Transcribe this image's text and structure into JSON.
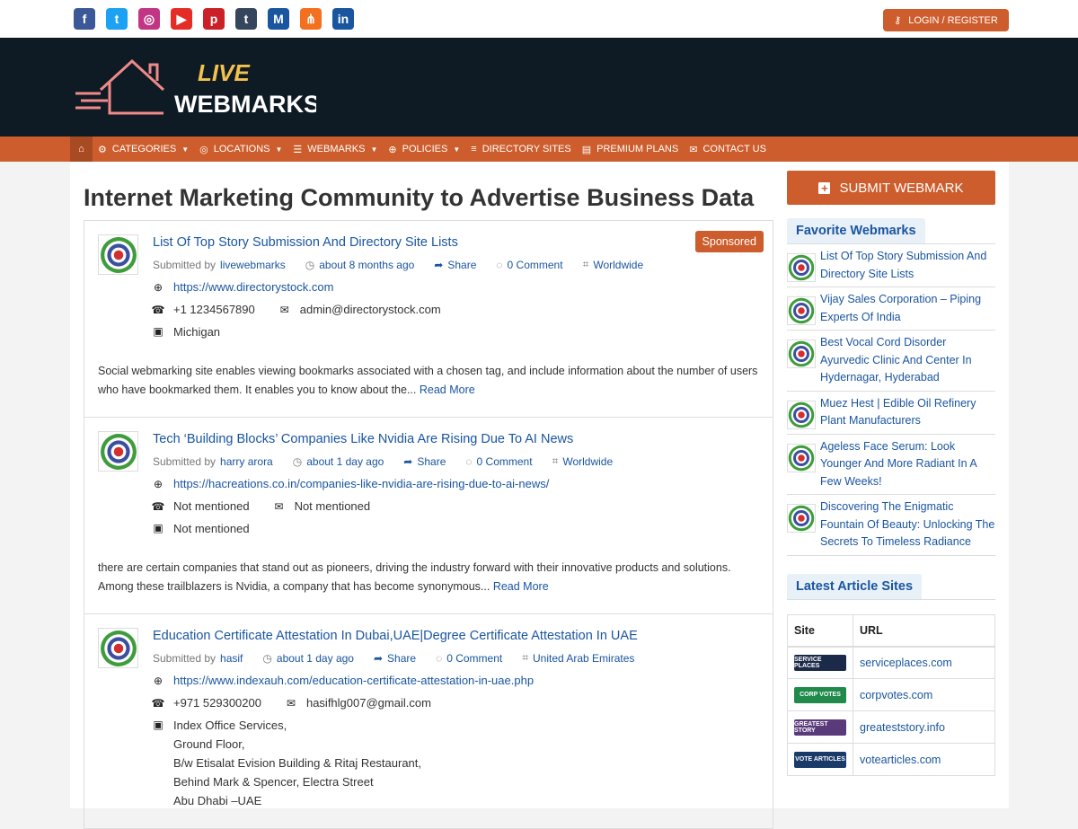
{
  "topbar": {
    "social": [
      {
        "icon": "facebook-icon",
        "glyph": "f",
        "color": "#3b5998"
      },
      {
        "icon": "twitter-icon",
        "glyph": "t",
        "color": "#1da1f2"
      },
      {
        "icon": "instagram-icon",
        "glyph": "◎",
        "color": "#c13584"
      },
      {
        "icon": "youtube-icon",
        "glyph": "▶",
        "color": "#e52d27"
      },
      {
        "icon": "pinterest-icon",
        "glyph": "p",
        "color": "#cb2027"
      },
      {
        "icon": "tumblr-icon",
        "glyph": "t",
        "color": "#35465c"
      },
      {
        "icon": "medium-icon",
        "glyph": "M",
        "color": "#1a55a0"
      },
      {
        "icon": "share-icon",
        "glyph": "⋔",
        "color": "#f37021"
      },
      {
        "icon": "linkedin-icon",
        "glyph": "in",
        "color": "#1a55a0"
      }
    ],
    "login_label": "LOGIN / REGISTER"
  },
  "logo": {
    "line1": "LIVE",
    "line2": "WEBMARKS"
  },
  "nav": [
    {
      "label": "CATEGORIES",
      "icon": "cogs-icon",
      "caret": true
    },
    {
      "label": "LOCATIONS",
      "icon": "compass-icon",
      "caret": true
    },
    {
      "label": "WEBMARKS",
      "icon": "list-icon",
      "caret": true
    },
    {
      "label": "POLICIES",
      "icon": "crosshair-icon",
      "caret": true
    },
    {
      "label": "DIRECTORY SITES",
      "icon": "align-icon",
      "caret": false
    },
    {
      "label": "PREMIUM PLANS",
      "icon": "file-icon",
      "caret": false
    },
    {
      "label": "CONTACT US",
      "icon": "envelope-icon",
      "caret": false
    }
  ],
  "main": {
    "title": "Internet Marketing Community to Advertise Business Data",
    "items": [
      {
        "title": "List Of Top Story Submission And Directory Site Lists",
        "submitted_by": "Submitted by",
        "author": "livewebmarks",
        "time": "about 8 months ago",
        "share": "Share",
        "comments": "0 Comment",
        "location": "Worldwide",
        "url": "https://www.directorystock.com",
        "phone": "+1 1234567890",
        "email": "admin@directorystock.com",
        "address": [
          "Michigan"
        ],
        "description": "Social webmarking site enables viewing bookmarks associated with a chosen tag, and include information about the number of users who have bookmarked them. It enables you to know about the...",
        "read_more": "Read More",
        "sponsored": "Sponsored"
      },
      {
        "title": "Tech ‘Building Blocks’ Companies Like Nvidia Are Rising Due To AI News",
        "submitted_by": "Submitted by",
        "author": "harry arora",
        "time": "about 1 day ago",
        "share": "Share",
        "comments": "0 Comment",
        "location": "Worldwide",
        "url": "https://hacreations.co.in/companies-like-nvidia-are-rising-due-to-ai-news/",
        "phone": "Not mentioned",
        "email": "Not mentioned",
        "address": [
          "Not mentioned"
        ],
        "description": "there are certain companies that stand out as pioneers, driving the industry forward with their innovative products and solutions. Among these trailblazers is Nvidia, a company that has become synonymous...",
        "read_more": "Read More",
        "sponsored": ""
      },
      {
        "title": "Education Certificate Attestation In Dubai,UAE|Degree Certificate Attestation In UAE",
        "submitted_by": "Submitted by",
        "author": "hasif",
        "time": "about 1 day ago",
        "share": "Share",
        "comments": "0 Comment",
        "location": "United Arab Emirates",
        "url": "https://www.indexauh.com/education-certificate-attestation-in-uae.php",
        "phone": "+971 529300200",
        "email": "hasifhlg007@gmail.com",
        "address": [
          "Index Office Services,",
          "Ground Floor,",
          "B/w Etisalat Evision Building & Ritaj Restaurant,",
          "Behind Mark & Spencer, Electra Street",
          "Abu Dhabi –UAE"
        ],
        "description": "",
        "read_more": "",
        "sponsored": ""
      }
    ]
  },
  "sidebar": {
    "submit_label": "SUBMIT WEBMARK",
    "favorites_title": "Favorite Webmarks",
    "favorites": [
      "List Of Top Story Submission And Directory Site Lists",
      "Vijay Sales Corporation – Piping Experts Of India",
      "Best Vocal Cord Disorder Ayurvedic Clinic And Center In Hydernagar, Hyderabad",
      "Muez Hest | Edible Oil Refinery Plant Manufacturers",
      "Ageless Face Serum: Look Younger And More Radiant In A Few Weeks!",
      "Discovering The Enigmatic Fountain Of Beauty: Unlocking The Secrets To Timeless Radiance"
    ],
    "latest_title": "Latest Article Sites",
    "table_headers": [
      "Site",
      "URL"
    ],
    "sites": [
      {
        "logo": "SERVICE PLACES",
        "url": "serviceplaces.com",
        "color": "#1c2a4a"
      },
      {
        "logo": "CORP VOTES",
        "url": "corpvotes.com",
        "color": "#1f8a4a"
      },
      {
        "logo": "GREATEST STORY",
        "url": "greateststory.info",
        "color": "#5a3a7a"
      },
      {
        "logo": "VOTE ARTICLES",
        "url": "votearticles.com",
        "color": "#1a3a6a"
      }
    ]
  }
}
